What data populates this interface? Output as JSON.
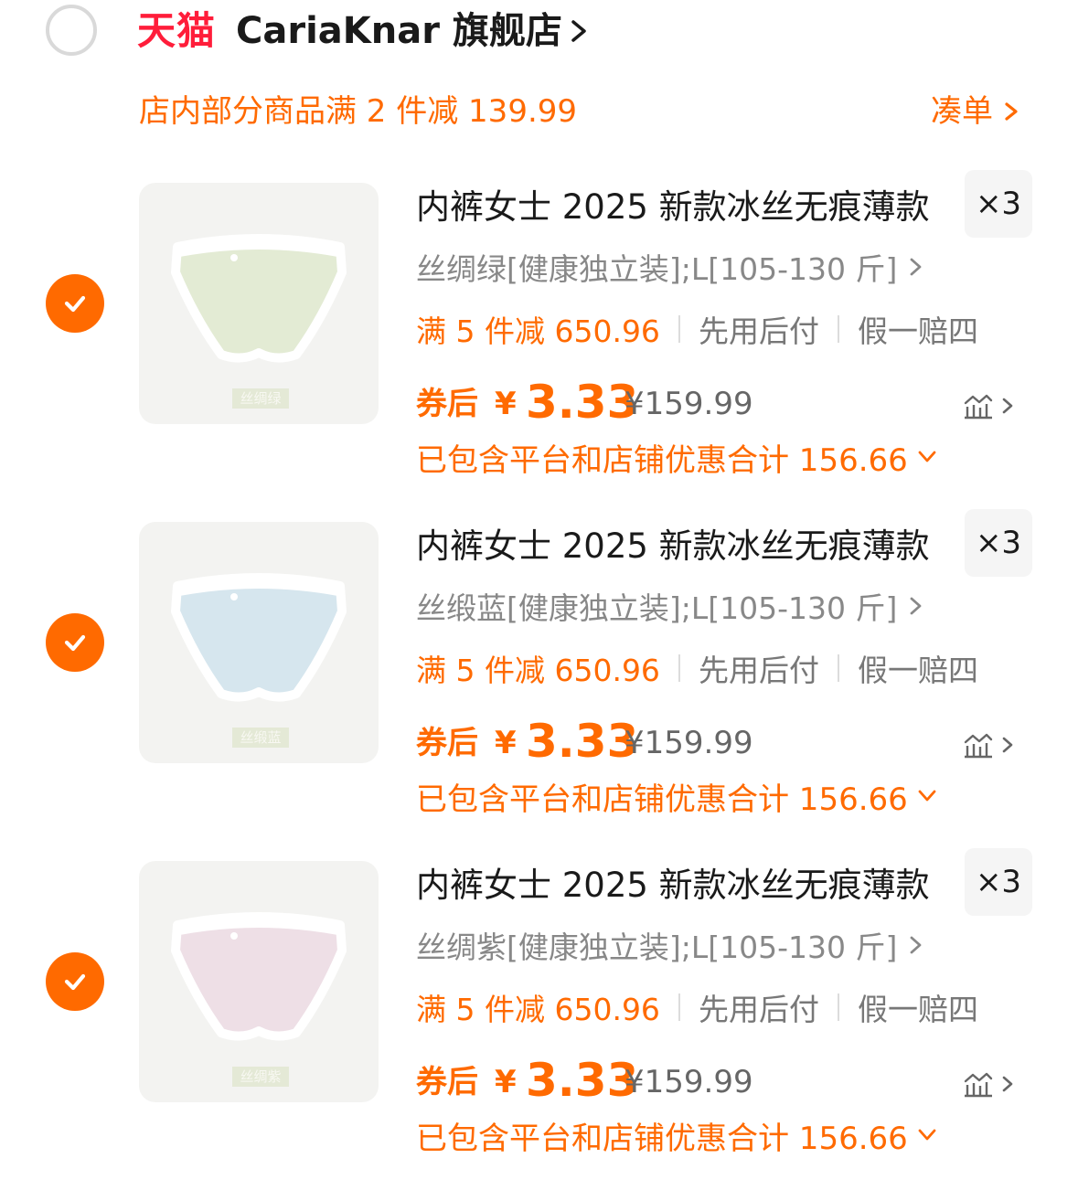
{
  "store": {
    "platform_logo": "天猫",
    "name": "CariaKnar 旗舰店",
    "selected": false
  },
  "promo": {
    "text": "店内部分商品满 2 件减 139.99",
    "link_label": "凑单"
  },
  "colors": {
    "accent": "#ff6a00",
    "tmall_red": "#ff1d3a",
    "muted": "#888888"
  },
  "items": [
    {
      "selected": true,
      "title": "内裤女士 2025 新款冰丝无痕薄款",
      "quantity": "×3",
      "sku": "丝绸绿[健康独立装];L[105-130 斤]",
      "thumb_label": "丝绸绿",
      "thumb_color": "#e3ebd4",
      "tag_promo": "满 5 件减 650.96",
      "tag_pay": "先用后付",
      "tag_guarantee": "假一赔四",
      "price_label": "券后",
      "price_currency": "¥",
      "price": "3.33",
      "original_price": "¥159.99",
      "discount_note": "已包含平台和店铺优惠合计 156.66"
    },
    {
      "selected": true,
      "title": "内裤女士 2025 新款冰丝无痕薄款",
      "quantity": "×3",
      "sku": "丝缎蓝[健康独立装];L[105-130 斤]",
      "thumb_label": "丝缎蓝",
      "thumb_color": "#d6e6ee",
      "tag_promo": "满 5 件减 650.96",
      "tag_pay": "先用后付",
      "tag_guarantee": "假一赔四",
      "price_label": "券后",
      "price_currency": "¥",
      "price": "3.33",
      "original_price": "¥159.99",
      "discount_note": "已包含平台和店铺优惠合计 156.66"
    },
    {
      "selected": true,
      "title": "内裤女士 2025 新款冰丝无痕薄款",
      "quantity": "×3",
      "sku": "丝绸紫[健康独立装];L[105-130 斤]",
      "thumb_label": "丝绸紫",
      "thumb_color": "#eedfe6",
      "tag_promo": "满 5 件减 650.96",
      "tag_pay": "先用后付",
      "tag_guarantee": "假一赔四",
      "price_label": "券后",
      "price_currency": "¥",
      "price": "3.33",
      "original_price": "¥159.99",
      "discount_note": "已包含平台和店铺优惠合计 156.66"
    }
  ],
  "icons": {
    "store_check": "empty-circle-icon",
    "item_check": "checkmark-circle-icon",
    "chevron": "chevron-right-icon",
    "dropdown": "chevron-down-icon",
    "trend": "price-trend-icon"
  }
}
